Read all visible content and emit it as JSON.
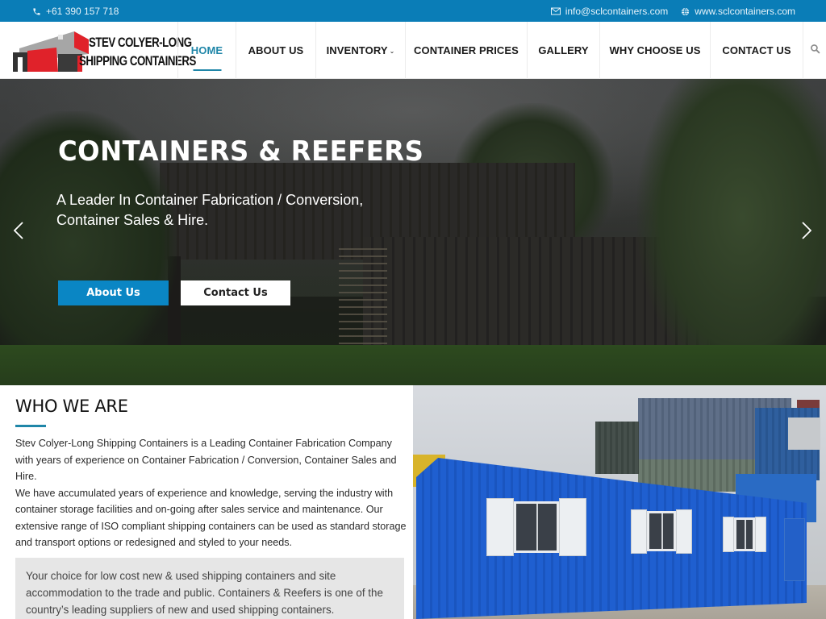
{
  "topbar": {
    "phone": "+61 390 157 718",
    "email": "info@sclcontainers.com",
    "website": "www.sclcontainers.com",
    "icons": {
      "phone": "phone-icon",
      "email": "envelope-icon",
      "website": "globe-icon"
    }
  },
  "header": {
    "logo": {
      "line1": "STEV COLYER-LONG",
      "line2": "SHIPPING CONTAINERS"
    },
    "nav": [
      {
        "label": "HOME",
        "active": true
      },
      {
        "label": "ABOUT US"
      },
      {
        "label": "INVENTORY",
        "has_dropdown": true
      },
      {
        "label": "CONTAINER PRICES"
      },
      {
        "label": "GALLERY"
      },
      {
        "label": "WHY CHOOSE US"
      },
      {
        "label": "CONTACT US"
      }
    ],
    "search_icon": "search-icon"
  },
  "hero": {
    "title": "CONTAINERS & REEFERS",
    "subtitle": "A Leader In Container Fabrication / Conversion, Container Sales & Hire.",
    "buttons": {
      "primary": "About Us",
      "secondary": "Contact Us"
    },
    "prev_label": "‹",
    "next_label": "›"
  },
  "who": {
    "heading": "WHO WE ARE",
    "paragraph1": "Stev Colyer-Long Shipping Containers is a Leading Container Fabrication Company with years of experience on Container Fabrication / Conversion, Container Sales and Hire.",
    "paragraph2": "We have accumulated years of experience and knowledge, serving the industry with container storage facilities and on-going after sales service and maintenance. Our extensive range of ISO compliant shipping containers can be used as standard storage and transport options or redesigned and styled to your needs.",
    "quote": "Your choice for low cost new & used shipping containers and site accommodation to the trade and public. Containers & Reefers is one of the country’s leading suppliers of new and used shipping containers."
  },
  "colors": {
    "topbar": "#0a7db7",
    "accent": "#1f86a8",
    "primary_button": "#0a86c4",
    "logo_red": "#e0222a",
    "logo_gray": "#9a9a9a",
    "logo_dark": "#333333"
  }
}
